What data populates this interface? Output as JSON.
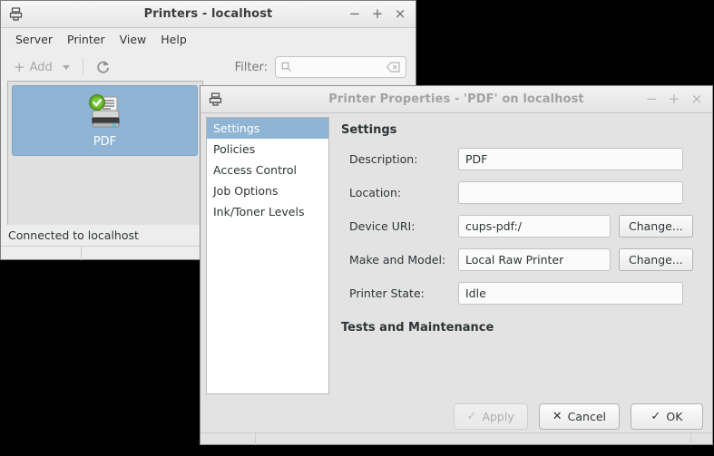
{
  "printers_window": {
    "title": "Printers - localhost",
    "icon": "printer-icon",
    "window_buttons": {
      "minimize": "−",
      "maximize": "+",
      "close": "×"
    },
    "menu": [
      {
        "label": "Server"
      },
      {
        "label": "Printer"
      },
      {
        "label": "View"
      },
      {
        "label": "Help"
      }
    ],
    "toolbar": {
      "add_label": "Add",
      "add_plus": "+",
      "add_dropdown_icon": "chevron-down-icon",
      "refresh_icon": "refresh-icon",
      "filter_label": "Filter:",
      "filter_value": "",
      "filter_placeholder": "",
      "search_icon": "search-icon",
      "clear_icon": "clear-backspace-icon"
    },
    "printers": [
      {
        "name": "PDF",
        "icon": "printer-ok-icon",
        "selected": true
      }
    ],
    "statusbar": "Connected to localhost"
  },
  "properties_dialog": {
    "title": "Printer Properties - 'PDF' on localhost",
    "icon": "printer-icon",
    "window_buttons": {
      "minimize": "−",
      "maximize": "+",
      "close": "×"
    },
    "nav_items": [
      {
        "label": "Settings",
        "selected": true
      },
      {
        "label": "Policies",
        "selected": false
      },
      {
        "label": "Access Control",
        "selected": false
      },
      {
        "label": "Job Options",
        "selected": false
      },
      {
        "label": "Ink/Toner Levels",
        "selected": false
      }
    ],
    "settings": {
      "heading": "Settings",
      "fields": [
        {
          "label": "Description:",
          "value": "PDF",
          "button": null
        },
        {
          "label": "Location:",
          "value": "",
          "button": null
        },
        {
          "label": "Device URI:",
          "value": "cups-pdf:/",
          "button": "Change..."
        },
        {
          "label": "Make and Model:",
          "value": "Local Raw Printer",
          "button": "Change..."
        },
        {
          "label": "Printer State:",
          "value": "Idle",
          "button": null
        }
      ],
      "tests_heading": "Tests and Maintenance"
    },
    "buttons": {
      "apply": {
        "label": "Apply",
        "glyph": "✓",
        "disabled": true
      },
      "cancel": {
        "label": "Cancel",
        "glyph": "✕",
        "disabled": false
      },
      "ok": {
        "label": "OK",
        "glyph": "✓",
        "disabled": false
      }
    }
  },
  "colors": {
    "selection_blue": "#8fb4d4",
    "window_bg": "#ededed",
    "dialog_bg": "#e3e3e3",
    "text": "#2e3436",
    "disabled_text": "#a8a8a8",
    "badge_green": "#4caf27"
  }
}
